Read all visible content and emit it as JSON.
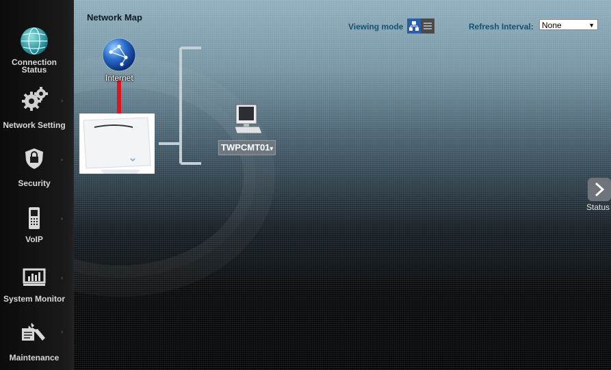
{
  "sidebar": {
    "items": [
      {
        "label_line1": "Connection",
        "label_line2": "Status",
        "icon": "globe-icon"
      },
      {
        "label": "Network Setting",
        "icon": "gears-icon"
      },
      {
        "label": "Security",
        "icon": "shield-icon"
      },
      {
        "label": "VoIP",
        "icon": "phone-icon"
      },
      {
        "label": "System Monitor",
        "icon": "monitor-chart-icon"
      },
      {
        "label": "Maintenance",
        "icon": "wrench-icon"
      }
    ]
  },
  "header": {
    "title": "Network Map",
    "viewing_mode_label": "Viewing mode",
    "refresh_label": "Refresh Interval:",
    "refresh_value": "None"
  },
  "map": {
    "internet_label": "Internet",
    "device_name": "TWPCMT01",
    "link_color": "#e0141c"
  },
  "status_tab": {
    "label": "Status"
  }
}
